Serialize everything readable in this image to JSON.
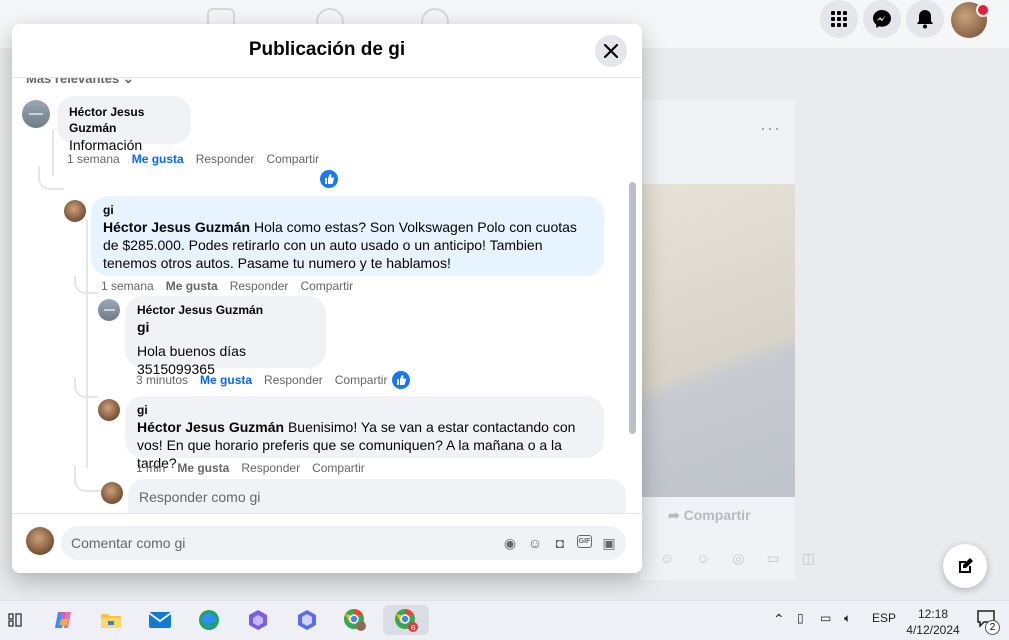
{
  "modal": {
    "title": "Publicación de gi",
    "sort_label": "Más relevantes ⌄",
    "comment_placeholder": "Comentar como gi"
  },
  "comments": [
    {
      "author": "Héctor Jesus Guzmán",
      "text": "Información",
      "time": "1 semana",
      "like": "Me gusta",
      "reply": "Responder",
      "share": "Compartir"
    },
    {
      "author": "gi",
      "mention": "Héctor Jesus Guzmán",
      "text": " Hola como estas? Son Volkswagen Polo con cuotas de $285.000. Podes retirarlo con un auto usado o un anticipo! Tambien tenemos otros autos. Pasame tu numero y te hablamos!",
      "time": "1 semana",
      "like": "Me gusta",
      "reply": "Responder",
      "share": "Compartir"
    },
    {
      "author": "Héctor Jesus Guzmán",
      "mention": "gi",
      "text": "Hola buenos días 3515099365",
      "time": "3 minutos",
      "like": "Me gusta",
      "reply": "Responder",
      "share": "Compartir"
    },
    {
      "author": "gi",
      "mention": "Héctor Jesus Guzmán",
      "text": " Buenisimo! Ya se van a estar contactando con vos! En que horario preferis que se comuniquen? A la mañana o a la tarde?",
      "time": "1 min",
      "like": "Me gusta",
      "reply": "Responder",
      "share": "Compartir"
    }
  ],
  "reply_box": {
    "placeholder": "Responder como gi"
  },
  "background": {
    "share_label": "Compartir"
  },
  "taskbar": {
    "language": "ESP",
    "time": "12:18",
    "date": "4/12/2024",
    "notification_count": "2"
  },
  "colors": {
    "accent": "#0866ff",
    "like_badge": "#1877f2",
    "bubble": "#f0f2f5",
    "highlight_bubble": "#e7f3ff"
  }
}
